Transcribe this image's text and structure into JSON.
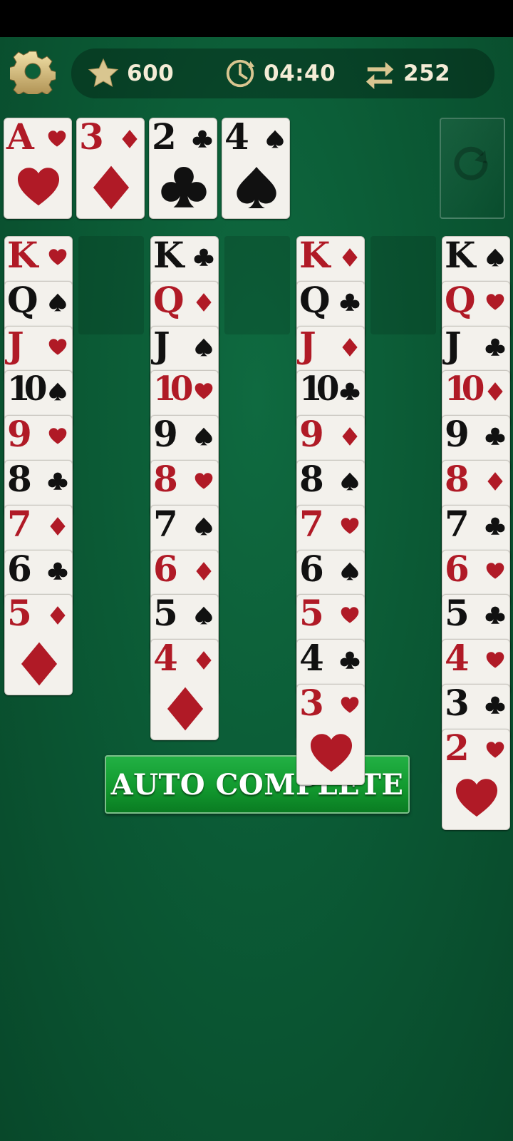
{
  "hud": {
    "score": "600",
    "time": "04:40",
    "moves": "252",
    "icons": [
      "gear-icon",
      "star-icon",
      "clock-icon",
      "swap-arrows-icon"
    ]
  },
  "auto_complete_label": "AUTO COMPLETE",
  "colors": {
    "felt": "#0b5a35",
    "red_suit": "#b01a26",
    "black_suit": "#111111",
    "hud_gold": "#d6c28a",
    "button_green": "#129a2f"
  },
  "foundations": [
    {
      "rank": "A",
      "suit": "hearts"
    },
    {
      "rank": "3",
      "suit": "diamonds"
    },
    {
      "rank": "2",
      "suit": "clubs"
    },
    {
      "rank": "4",
      "suit": "spades"
    }
  ],
  "tableau": [
    [
      {
        "rank": "K",
        "suit": "hearts"
      },
      {
        "rank": "Q",
        "suit": "spades"
      },
      {
        "rank": "J",
        "suit": "hearts"
      },
      {
        "rank": "10",
        "suit": "spades"
      },
      {
        "rank": "9",
        "suit": "hearts"
      },
      {
        "rank": "8",
        "suit": "clubs"
      },
      {
        "rank": "7",
        "suit": "diamonds"
      },
      {
        "rank": "6",
        "suit": "clubs"
      },
      {
        "rank": "5",
        "suit": "diamonds"
      }
    ],
    [],
    [
      {
        "rank": "K",
        "suit": "clubs"
      },
      {
        "rank": "Q",
        "suit": "diamonds"
      },
      {
        "rank": "J",
        "suit": "spades"
      },
      {
        "rank": "10",
        "suit": "hearts"
      },
      {
        "rank": "9",
        "suit": "spades"
      },
      {
        "rank": "8",
        "suit": "hearts"
      },
      {
        "rank": "7",
        "suit": "spades"
      },
      {
        "rank": "6",
        "suit": "diamonds"
      },
      {
        "rank": "5",
        "suit": "spades"
      },
      {
        "rank": "4",
        "suit": "diamonds"
      }
    ],
    [],
    [
      {
        "rank": "K",
        "suit": "diamonds"
      },
      {
        "rank": "Q",
        "suit": "clubs"
      },
      {
        "rank": "J",
        "suit": "diamonds"
      },
      {
        "rank": "10",
        "suit": "clubs"
      },
      {
        "rank": "9",
        "suit": "diamonds"
      },
      {
        "rank": "8",
        "suit": "spades"
      },
      {
        "rank": "7",
        "suit": "hearts"
      },
      {
        "rank": "6",
        "suit": "spades"
      },
      {
        "rank": "5",
        "suit": "hearts"
      },
      {
        "rank": "4",
        "suit": "clubs"
      },
      {
        "rank": "3",
        "suit": "hearts"
      }
    ],
    [],
    [
      {
        "rank": "K",
        "suit": "spades"
      },
      {
        "rank": "Q",
        "suit": "hearts"
      },
      {
        "rank": "J",
        "suit": "clubs"
      },
      {
        "rank": "10",
        "suit": "diamonds"
      },
      {
        "rank": "9",
        "suit": "clubs"
      },
      {
        "rank": "8",
        "suit": "diamonds"
      },
      {
        "rank": "7",
        "suit": "clubs"
      },
      {
        "rank": "6",
        "suit": "hearts"
      },
      {
        "rank": "5",
        "suit": "clubs"
      },
      {
        "rank": "4",
        "suit": "hearts"
      },
      {
        "rank": "3",
        "suit": "clubs"
      },
      {
        "rank": "2",
        "suit": "hearts"
      }
    ]
  ]
}
